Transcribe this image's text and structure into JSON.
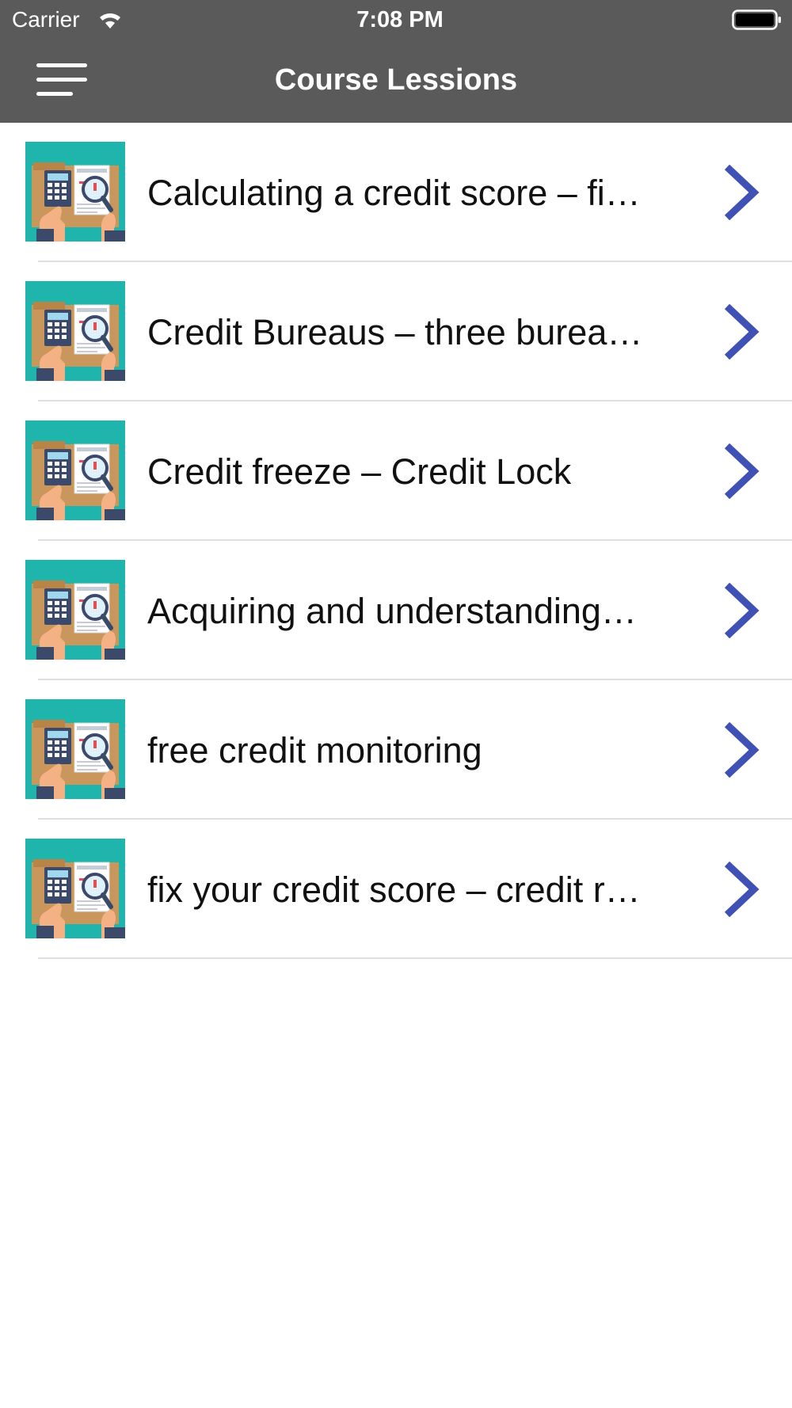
{
  "status_bar": {
    "carrier": "Carrier",
    "time": "7:08 PM"
  },
  "nav_bar": {
    "title": "Course Lessions",
    "menu_icon": "hamburger-menu-icon"
  },
  "lessons": [
    {
      "title": "Calculating a credit score – fi…",
      "thumbnail_icon": "credit-score-thumbnail"
    },
    {
      "title": "Credit Bureaus – three burea…",
      "thumbnail_icon": "credit-score-thumbnail"
    },
    {
      "title": "Credit freeze – Credit Lock",
      "thumbnail_icon": "credit-score-thumbnail"
    },
    {
      "title": "Acquiring and understanding…",
      "thumbnail_icon": "credit-score-thumbnail"
    },
    {
      "title": "free credit monitoring",
      "thumbnail_icon": "credit-score-thumbnail"
    },
    {
      "title": "fix your credit score – credit r…",
      "thumbnail_icon": "credit-score-thumbnail"
    }
  ],
  "colors": {
    "nav_background": "#5a5a5a",
    "chevron": "#3f51b5",
    "thumbnail_background": "#1fb5ad"
  }
}
